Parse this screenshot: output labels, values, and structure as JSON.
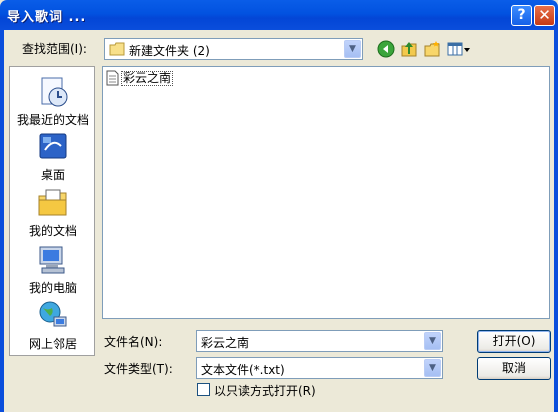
{
  "window": {
    "title": "导入歌词 ...",
    "help_label": "?",
    "close_label": "✕"
  },
  "lookin": {
    "label": "查找范围(I):",
    "value": "新建文件夹 (2)"
  },
  "places": [
    {
      "label": "我最近的文档",
      "icon": "recent-documents-icon"
    },
    {
      "label": "桌面",
      "icon": "desktop-icon"
    },
    {
      "label": "我的文档",
      "icon": "my-documents-icon"
    },
    {
      "label": "我的电脑",
      "icon": "my-computer-icon"
    },
    {
      "label": "网上邻居",
      "icon": "network-places-icon"
    }
  ],
  "files": [
    {
      "name": "彩云之南",
      "icon": "text-document-icon"
    }
  ],
  "filename": {
    "label": "文件名(N):",
    "value": "彩云之南"
  },
  "filetype": {
    "label": "文件类型(T):",
    "value": "文本文件(*.txt)"
  },
  "readonly": {
    "label": "以只读方式打开(R)",
    "checked": false
  },
  "buttons": {
    "open": "打开(O)",
    "cancel": "取消"
  },
  "colors": {
    "titlebar": "#0A4EDC",
    "dialog_bg": "#ECE9D8",
    "border": "#7F9DB9"
  }
}
